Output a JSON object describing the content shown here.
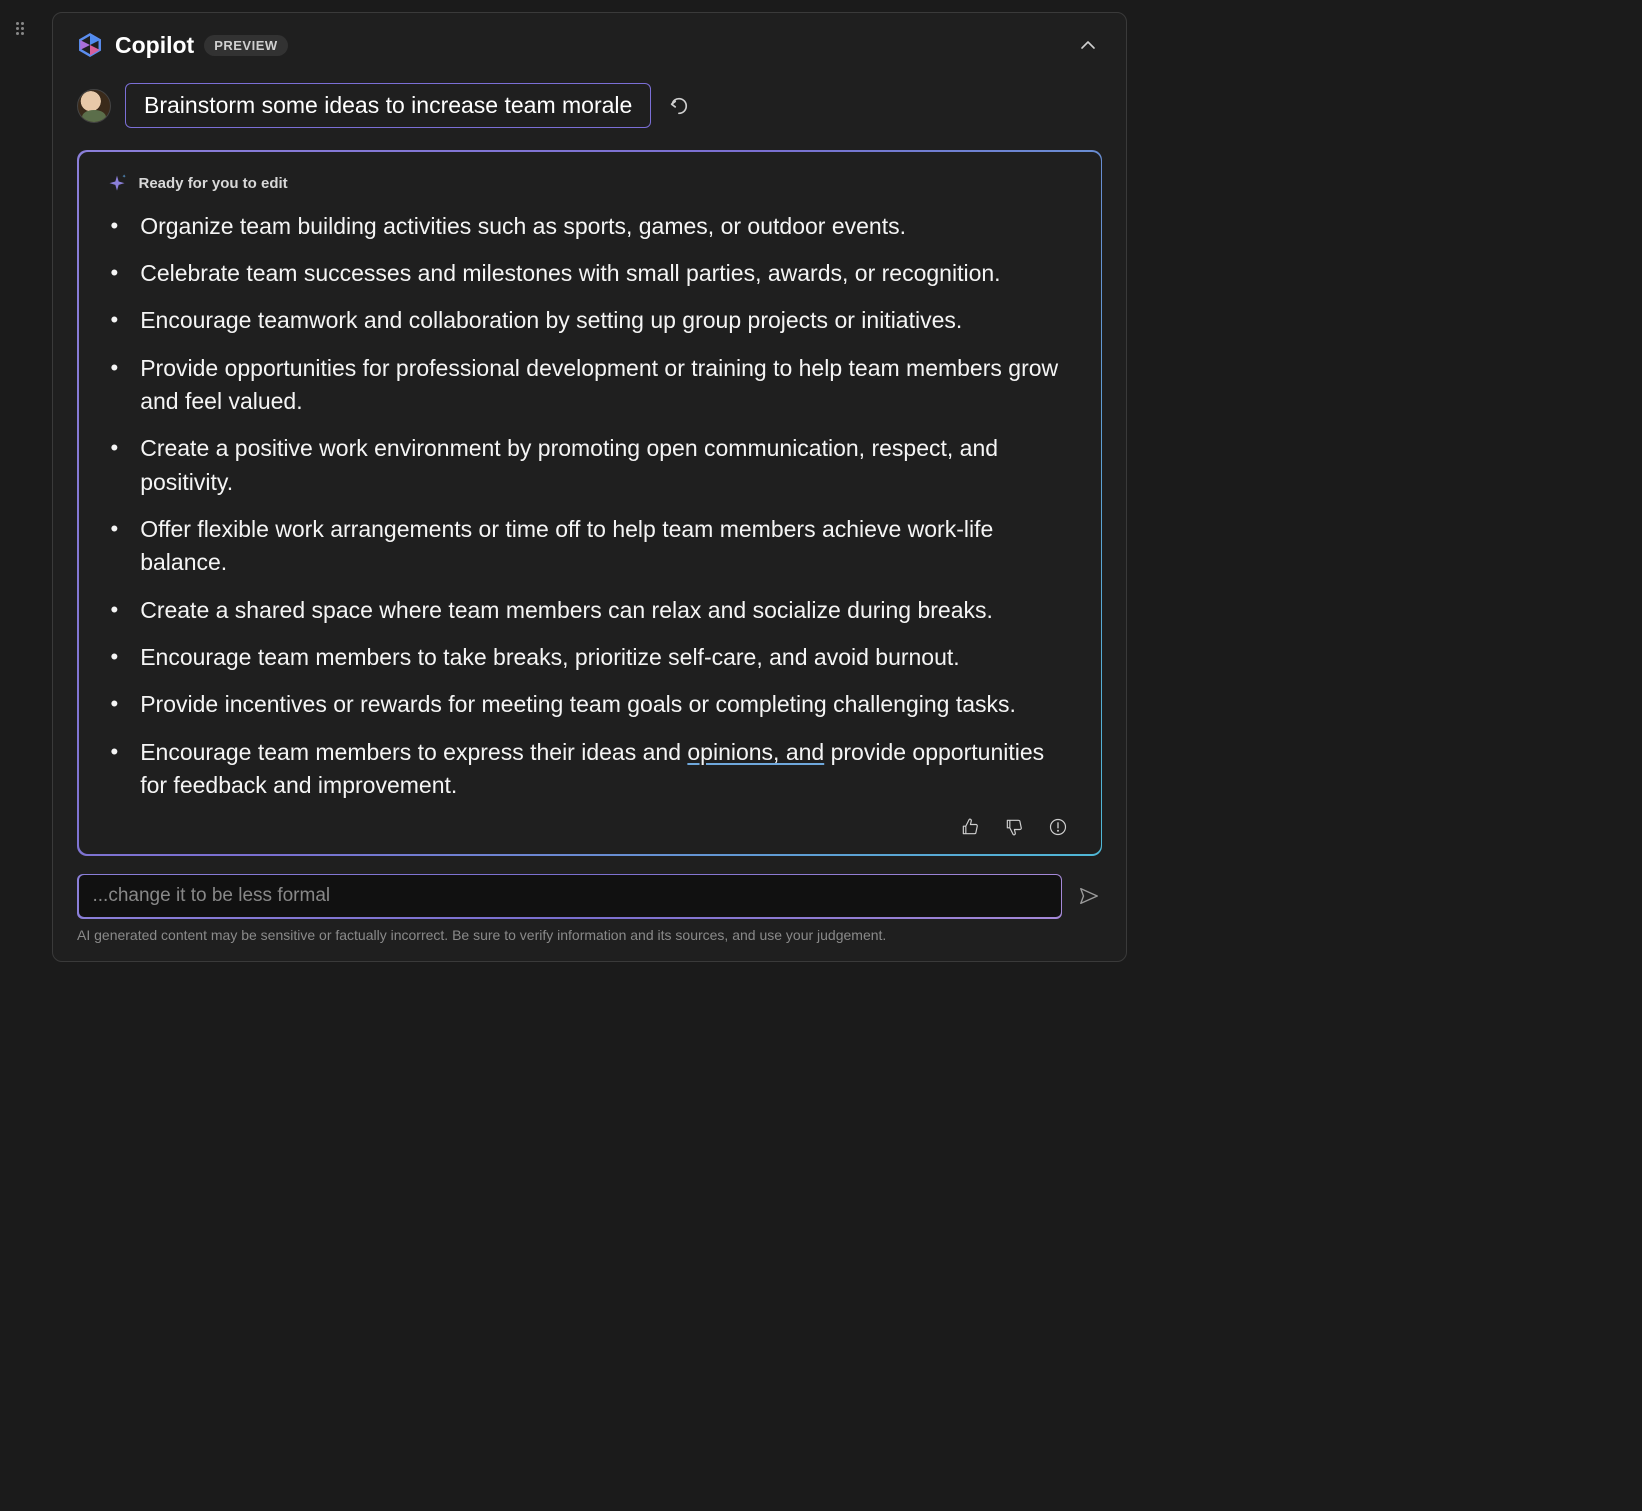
{
  "header": {
    "title": "Copilot",
    "badge": "PREVIEW"
  },
  "user_prompt": "Brainstorm some ideas to increase team morale",
  "response": {
    "status_text": "Ready for you to edit",
    "items": [
      "Organize team building activities such as sports, games, or outdoor events.",
      "Celebrate team successes and milestones with small parties, awards, or recognition.",
      "Encourage teamwork and collaboration by setting up group projects or initiatives.",
      "Provide opportunities for professional development or training to help team members grow and feel valued.",
      "Create a positive work environment by promoting open communication, respect, and positivity.",
      "Offer flexible work arrangements or time off to help team members achieve work-life balance.",
      "Create a shared space where team members can relax and socialize during breaks.",
      "Encourage team members to take breaks, prioritize self-care, and avoid burnout.",
      "Provide incentives or rewards for meeting team goals or completing challenging tasks.",
      "Encourage team members to express their ideas and opinions, and provide opportunities for feedback and improvement."
    ],
    "underlined_fragment": "opinions, and",
    "underlined_in_item_index": 9
  },
  "followup": {
    "placeholder": "...change it to be less formal"
  },
  "disclaimer": "AI generated content may be sensitive or factually incorrect. Be sure to verify information and its sources, and use your judgement."
}
